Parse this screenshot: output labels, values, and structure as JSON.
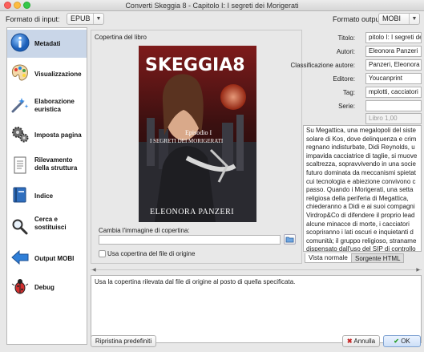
{
  "window": {
    "title": "Converti Skeggia 8 - Capitolo I: I segreti dei Morigerati"
  },
  "toolbar": {
    "input_format_label": "Formato di input:",
    "input_format_value": "EPUB",
    "output_format_label": "Formato output",
    "output_format_value": "MOBI"
  },
  "sidebar": {
    "items": [
      {
        "label": "Metadati",
        "icon": "info-icon"
      },
      {
        "label": "Visualizzazione",
        "icon": "palette-icon"
      },
      {
        "label": "Elaborazione euristica",
        "icon": "wizard-icon"
      },
      {
        "label": "Imposta pagina",
        "icon": "gears-icon"
      },
      {
        "label": "Rilevamento della struttura",
        "icon": "document-icon"
      },
      {
        "label": "Indice",
        "icon": "book-icon"
      },
      {
        "label": "Cerca e sostituisci",
        "icon": "search-replace-icon"
      },
      {
        "label": "Output MOBI",
        "icon": "arrow-left-icon"
      },
      {
        "label": "Debug",
        "icon": "bug-icon"
      }
    ]
  },
  "cover": {
    "section_label": "Copertina del libro",
    "book_title": "SKEGGIA8",
    "book_subtitle_1": "Episodio I",
    "book_subtitle_2": "I SEGRETI DEI MORIGERATI",
    "book_author": "ELEONORA PANZERI",
    "change_label": "Cambia l'immagine di copertina:",
    "path_value": "",
    "use_source_label": "Usa copertina del file di origine"
  },
  "metadata": {
    "title_label": "Titolo:",
    "title_value": "pitolo I: I segreti dei",
    "authors_label": "Autori:",
    "authors_value": "Eleonora Panzeri",
    "author_sort_label": "Classificazione autore:",
    "author_sort_value": "Panzeri, Eleonora",
    "publisher_label": "Editore:",
    "publisher_value": "Youcanprint",
    "tags_label": "Tag:",
    "tags_value": "mplotti, cacciatori",
    "series_label": "Serie:",
    "series_value": "",
    "series_index_placeholder": "Libro 1,00"
  },
  "description": {
    "lines": [
      "Su Megattica, una megalopoli del siste",
      "solare di Kos, dove delinquenza e crim",
      "regnano indisturbate, Didi Reynolds, u",
      "impavida cacciatrice di taglie, si muove",
      "scaltrezza, sopravvivendo in una socie",
      "futuro dominata da meccanismi spietat",
      "cui tecnologia e abiezione convivono c",
      "passo. Quando i Morigerati, una setta",
      "religiosa della periferia di Megattica,",
      "chiederanno a Didi e ai suoi compagni",
      "Virdrop&Co di difendere il proprio lead",
      "alcune minacce di morte, i cacciatori",
      "scopriranno i lati oscuri e inquietanti d",
      "comunità; il gruppo religioso, straname",
      "dispensato dall'uso del SIP di controllo",
      "obbligatorio del regime dei cadetti, ser",
      "nascondere segreti e sinistre verità."
    ],
    "tab_normal": "Vista normale",
    "tab_html": "Sorgente HTML"
  },
  "help": {
    "text": "Usa la copertina rilevata dal file di origine al posto di quella specificata."
  },
  "buttons": {
    "reset": "Ripristina predefiniti",
    "cancel": "Annulla",
    "ok": "OK"
  },
  "colors": {
    "selected_bg": "#c9d6e8",
    "ok_check": "#2a9d2a",
    "cancel_x": "#c62828"
  }
}
